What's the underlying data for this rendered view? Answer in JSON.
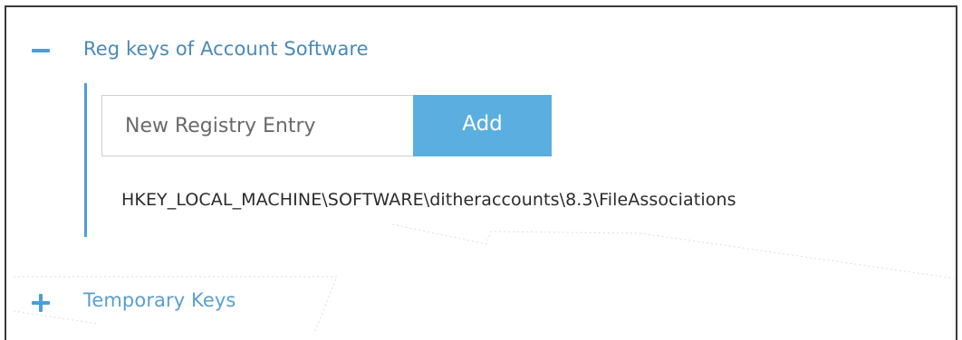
{
  "sections": [
    {
      "title": "Reg keys of Account Software",
      "toggle": "minus-icon",
      "expanded": true,
      "entry": {
        "placeholder": "New Registry Entry",
        "add_label": "Add"
      },
      "items": [
        "HKEY_LOCAL_MACHINE\\SOFTWARE\\ditheraccounts\\8.3\\FileAssociations"
      ]
    },
    {
      "title": "Temporary Keys",
      "toggle": "plus-icon",
      "expanded": false
    }
  ],
  "colors": {
    "accent": "#4a9fd8",
    "button": "#5aaee0",
    "title": "#4a8ab8"
  }
}
